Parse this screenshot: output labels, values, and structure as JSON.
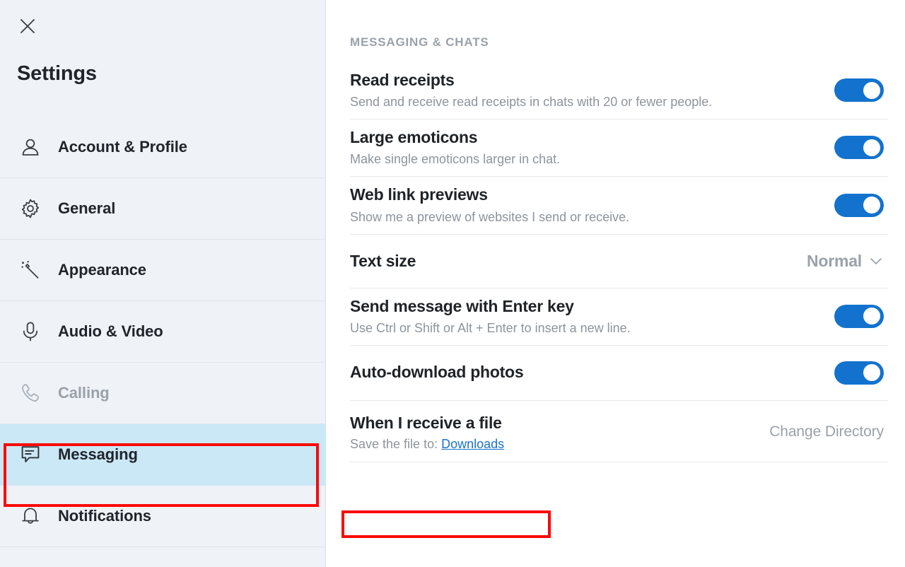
{
  "window": {
    "title": "Settings",
    "close_icon": "close-icon"
  },
  "sidebar": {
    "items": [
      {
        "label": "Account & Profile",
        "icon": "person-icon",
        "state": "normal"
      },
      {
        "label": "General",
        "icon": "gear-icon",
        "state": "normal"
      },
      {
        "label": "Appearance",
        "icon": "magic-wand-icon",
        "state": "normal"
      },
      {
        "label": "Audio & Video",
        "icon": "microphone-icon",
        "state": "normal"
      },
      {
        "label": "Calling",
        "icon": "phone-icon",
        "state": "disabled"
      },
      {
        "label": "Messaging",
        "icon": "chat-bubble-icon",
        "state": "selected"
      },
      {
        "label": "Notifications",
        "icon": "bell-icon",
        "state": "normal"
      }
    ]
  },
  "main": {
    "section_header": "MESSAGING & CHATS",
    "rows": [
      {
        "title": "Read receipts",
        "subtitle": "Send and receive read receipts in chats with 20 or fewer people.",
        "control": "toggle",
        "toggle_on": true
      },
      {
        "title": "Large emoticons",
        "subtitle": "Make single emoticons larger in chat.",
        "control": "toggle",
        "toggle_on": true
      },
      {
        "title": "Web link previews",
        "subtitle": "Show me a preview of websites I send or receive.",
        "control": "toggle",
        "toggle_on": true
      },
      {
        "title": "Text size",
        "subtitle": "",
        "control": "dropdown",
        "dropdown_value": "Normal"
      },
      {
        "title": "Send message with Enter key",
        "subtitle": "Use Ctrl or Shift or Alt + Enter to insert a new line.",
        "control": "toggle",
        "toggle_on": true
      },
      {
        "title": "Auto-download photos",
        "subtitle": "",
        "control": "toggle",
        "toggle_on": true
      },
      {
        "title": "When I receive a file",
        "subtitle_prefix": "Save the file to:",
        "subtitle_link": "Downloads",
        "control": "action",
        "action_label": "Change Directory"
      }
    ]
  },
  "annotations": {
    "color": "#fa0a08",
    "boxes": [
      {
        "target": "sidebar-item-messaging"
      },
      {
        "target": "save-file-to-line"
      }
    ]
  },
  "colors": {
    "accent": "#1272ce",
    "selected_row_bg": "#cbe8f7",
    "sidebar_bg": "#eff3f8",
    "link": "#1a73c8",
    "annotation_red": "#fa0a08"
  }
}
